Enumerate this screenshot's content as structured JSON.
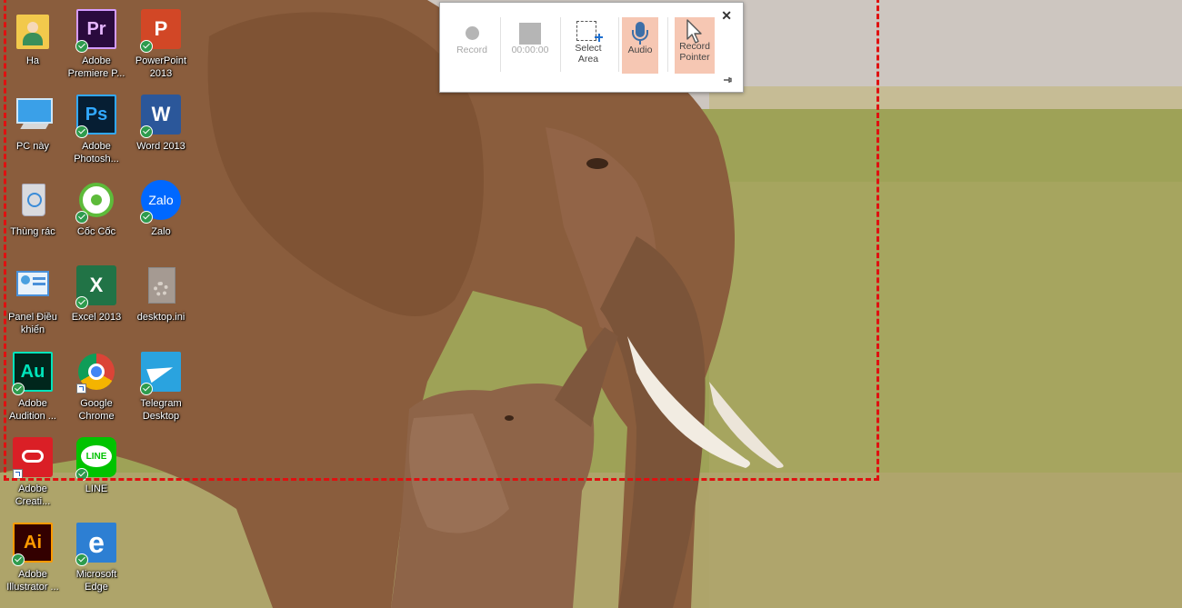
{
  "toolbar": {
    "record_label": "Record",
    "timer": "00:00:00",
    "select_area_label": "Select\nArea",
    "audio_label": "Audio",
    "record_pointer_label": "Record\nPointer",
    "close_glyph": "✕",
    "active_color": "#f6c7b3"
  },
  "selection": {
    "border_color": "#e01010",
    "style": "dashed"
  },
  "desktop": {
    "icons": [
      {
        "id": "ha",
        "label": "Ha"
      },
      {
        "id": "premiere",
        "label": "Adobe\nPremiere P..."
      },
      {
        "id": "powerpoint",
        "label": "PowerPoint\n2013"
      },
      {
        "id": "pc",
        "label": "PC này"
      },
      {
        "id": "photoshop",
        "label": "Adobe\nPhotosh..."
      },
      {
        "id": "word",
        "label": "Word 2013"
      },
      {
        "id": "recycle",
        "label": "Thùng rác"
      },
      {
        "id": "coccoc",
        "label": "Cốc Cốc"
      },
      {
        "id": "zalo",
        "label": "Zalo"
      },
      {
        "id": "panel",
        "label": "Panel Điều\nkhiển"
      },
      {
        "id": "excel",
        "label": "Excel 2013"
      },
      {
        "id": "desktopini",
        "label": "desktop.ini"
      },
      {
        "id": "audition",
        "label": "Adobe\nAudition ..."
      },
      {
        "id": "chrome",
        "label": "Google\nChrome"
      },
      {
        "id": "telegram",
        "label": "Telegram\nDesktop"
      },
      {
        "id": "creative",
        "label": "Adobe\nCreati..."
      },
      {
        "id": "line",
        "label": "LINE"
      },
      {
        "id": "illustrator",
        "label": "Adobe\nIllustrator ..."
      },
      {
        "id": "edge",
        "label": "Microsoft\nEdge"
      }
    ],
    "tile_text": {
      "premiere": "Pr",
      "powerpoint": "P",
      "photoshop": "Ps",
      "word": "W",
      "zalo": "Zalo",
      "excel": "X",
      "audition": "Au",
      "line": "LINE",
      "illustrator": "Ai",
      "edge": "e"
    }
  }
}
